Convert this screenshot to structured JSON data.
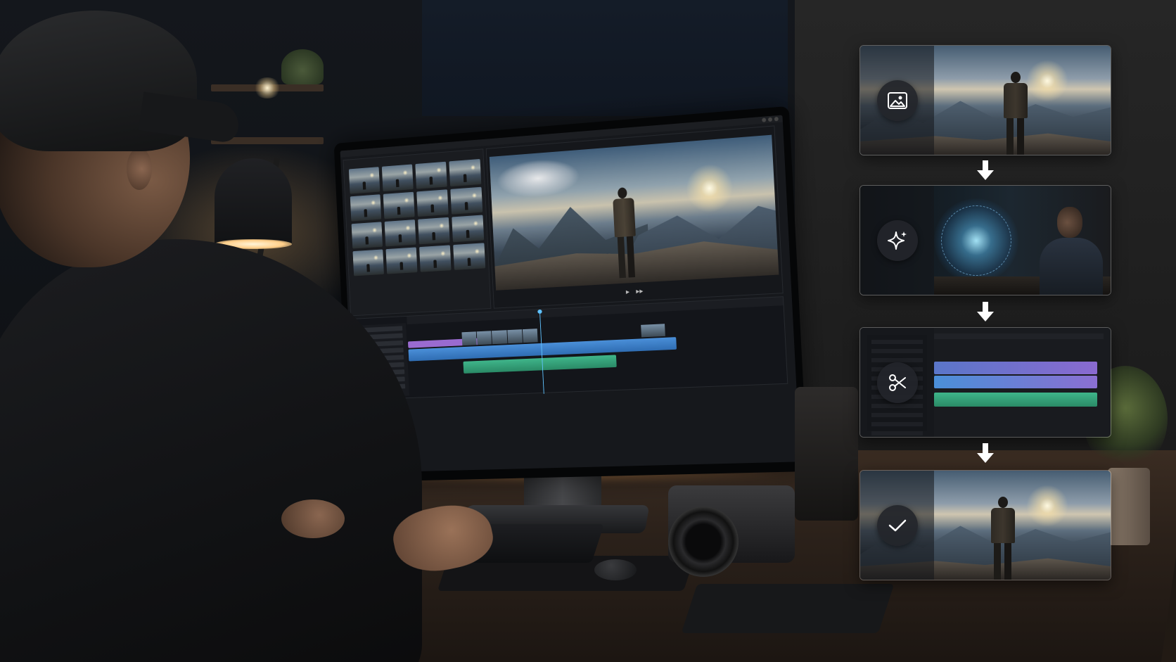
{
  "scene": {
    "accent_glow": "#ffb070",
    "timeline_colors": {
      "video": "#9a6bd0",
      "main": "#4a8fd8",
      "audio": "#3fb58a",
      "playhead": "#5fc2ff"
    }
  },
  "editor": {
    "media_thumbnail_count": 16,
    "transport": {
      "play": "▶",
      "step": "▶▶"
    }
  },
  "workflow": {
    "steps": [
      {
        "id": "import",
        "icon": "image-icon"
      },
      {
        "id": "ai-enhance",
        "icon": "sparkle-icon"
      },
      {
        "id": "edit",
        "icon": "scissors-icon"
      },
      {
        "id": "export",
        "icon": "checkmark-icon"
      }
    ],
    "arrow_color": "#ffffff"
  }
}
